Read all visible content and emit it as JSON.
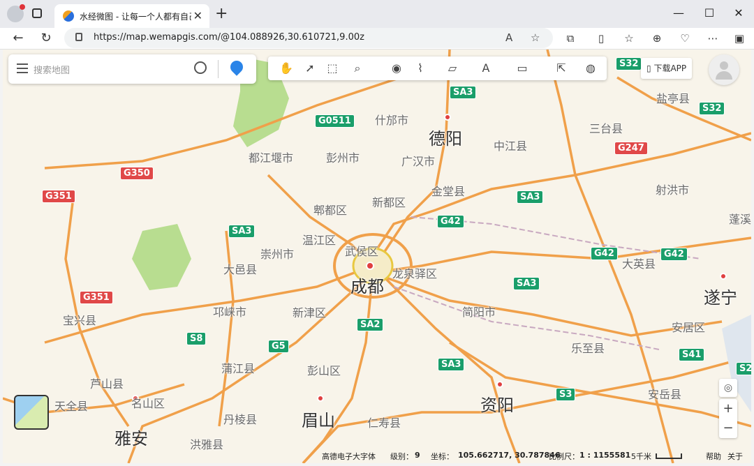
{
  "browser": {
    "tab_title": "水经微图 - 让每一个人都有自己的",
    "tab_close": "✕",
    "new_tab": "+",
    "url": "https://map.wemapgis.com/@104.088926,30.610721,9.00z",
    "buttons": {
      "minimize": "—",
      "maximize": "☐",
      "close": "✕"
    }
  },
  "search": {
    "placeholder": "搜索地图"
  },
  "toolbar": {
    "download_app": "下载APP"
  },
  "map": {
    "cities_major": [
      {
        "name": "成都"
      },
      {
        "name": "德阳"
      },
      {
        "name": "资阳"
      },
      {
        "name": "眉山"
      },
      {
        "name": "遂宁"
      },
      {
        "name": "雅安"
      }
    ],
    "places": [
      {
        "name": "什邡市"
      },
      {
        "name": "中江县"
      },
      {
        "name": "三台县"
      },
      {
        "name": "盐亭县"
      },
      {
        "name": "都江堰市"
      },
      {
        "name": "彭州市"
      },
      {
        "name": "广汉市"
      },
      {
        "name": "射洪市"
      },
      {
        "name": "金堂县"
      },
      {
        "name": "新都区"
      },
      {
        "name": "郫都区"
      },
      {
        "name": "温江区"
      },
      {
        "name": "崇州市"
      },
      {
        "name": "武侯区"
      },
      {
        "name": "龙泉驿区"
      },
      {
        "name": "大邑县"
      },
      {
        "name": "大英县"
      },
      {
        "name": "蓬溪"
      },
      {
        "name": "邛崃市"
      },
      {
        "name": "新津区"
      },
      {
        "name": "简阳市"
      },
      {
        "name": "宝兴县"
      },
      {
        "name": "安居区"
      },
      {
        "name": "乐至县"
      },
      {
        "name": "蒲江县"
      },
      {
        "name": "彭山区"
      },
      {
        "name": "芦山县"
      },
      {
        "name": "安岳县"
      },
      {
        "name": "天全县"
      },
      {
        "name": "名山区"
      },
      {
        "name": "丹棱县"
      },
      {
        "name": "仁寿县"
      },
      {
        "name": "洪雅县"
      }
    ],
    "shields": [
      {
        "code": "S32",
        "style": "g"
      },
      {
        "code": "SA3",
        "style": "g"
      },
      {
        "code": "G0511",
        "style": "g"
      },
      {
        "code": "S32",
        "style": "g"
      },
      {
        "code": "G247",
        "style": "r"
      },
      {
        "code": "G350",
        "style": "r"
      },
      {
        "code": "G351",
        "style": "r"
      },
      {
        "code": "SA3",
        "style": "g"
      },
      {
        "code": "G42",
        "style": "g"
      },
      {
        "code": "SA3",
        "style": "g"
      },
      {
        "code": "G42",
        "style": "g"
      },
      {
        "code": "G42",
        "style": "g"
      },
      {
        "code": "G351",
        "style": "r"
      },
      {
        "code": "SA3",
        "style": "g"
      },
      {
        "code": "SA2",
        "style": "g"
      },
      {
        "code": "S8",
        "style": "g"
      },
      {
        "code": "G5",
        "style": "g"
      },
      {
        "code": "SA3",
        "style": "g"
      },
      {
        "code": "S41",
        "style": "g"
      },
      {
        "code": "S3",
        "style": "g"
      },
      {
        "code": "S2",
        "style": "g"
      }
    ]
  },
  "status": {
    "font": "高德电子大字体",
    "level_label": "级别：",
    "level": "9",
    "coord_label": "坐标：",
    "coord": "105.662717, 30.787846",
    "scale_label": "比例尺：",
    "scale": "1 : 1155581",
    "scale_dist": "5千米",
    "help": "帮助",
    "about": "关于"
  }
}
